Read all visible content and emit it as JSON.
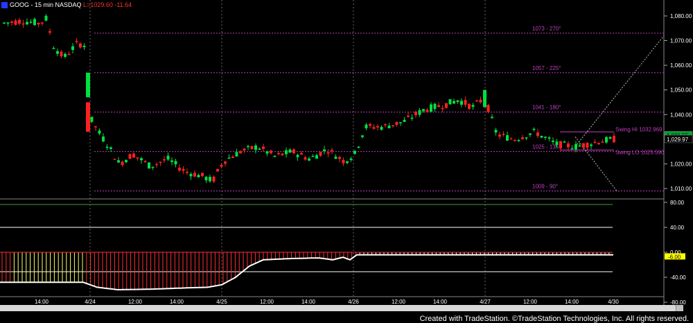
{
  "header": {
    "symbol": "GOOG - 15 min  NASDAQ",
    "last": "L=1029.60  -11.64"
  },
  "footer": "Created with TradeStation. ©TradeStation Technologies, Inc. All rights reserved.",
  "colors": {
    "up": "#00e040",
    "down": "#ff2020",
    "level": "#c040c0",
    "osc_line": "#ffffff",
    "hist_red": "#ff3030",
    "hist_yellow": "#ffff60"
  },
  "chart_data": [
    {
      "type": "candlestick",
      "price_axis": {
        "ticks": [
          "1,080.00",
          "1,070.00",
          "1,060.00",
          "1,050.00",
          "1,040.00",
          "1,030.00",
          "1,020.00",
          "1,010.00"
        ],
        "range": [
          1005,
          1086
        ]
      },
      "time_labels": [
        "14:00",
        "4/24",
        "12:00",
        "14:00",
        "4/25",
        "12:00",
        "14:00",
        "4/26",
        "12:00",
        "14:00",
        "4/27",
        "12:00",
        "14:00",
        "4/30"
      ],
      "levels": [
        {
          "label": "1073 - 270°",
          "value": 1073
        },
        {
          "label": "1057 - 225°",
          "value": 1057
        },
        {
          "label": "1041 - 180°",
          "value": 1041
        },
        {
          "label": "1025 - 135°",
          "value": 1025
        },
        {
          "label": "1009 - 90°",
          "value": 1009
        }
      ],
      "swing_labels": [
        {
          "label": "Swing HI 1032.969",
          "value": 1032.969
        },
        {
          "label": "Swing LO 1025.590",
          "value": 1025.59
        }
      ],
      "last_price_labels": [
        "1,031.55",
        "1,029.97"
      ]
    },
    {
      "type": "oscillator",
      "axis_ticks": [
        "80.00",
        "40.00",
        "0.00",
        "-40.00",
        "-80.00"
      ],
      "range": [
        -100,
        100
      ],
      "current_value": "-6.00"
    }
  ]
}
